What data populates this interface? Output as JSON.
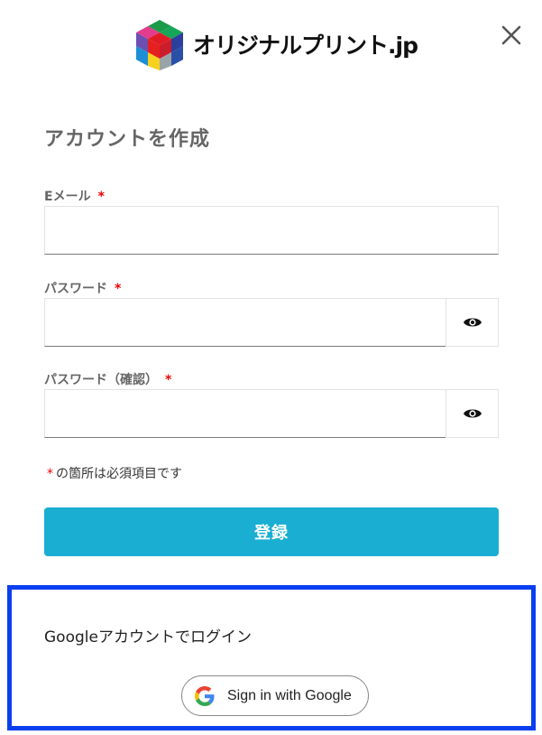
{
  "header": {
    "logo_text": "オリジナルプリント.jp",
    "close_icon": "close-icon"
  },
  "form": {
    "title": "アカウントを作成",
    "required_mark": "*",
    "email": {
      "label": "Eメール",
      "value": "",
      "placeholder": ""
    },
    "password": {
      "label": "パスワード",
      "value": "",
      "placeholder": ""
    },
    "password_confirm": {
      "label": "パスワード（確認）",
      "value": "",
      "placeholder": ""
    },
    "toggle_icon": "eye-icon",
    "note_mark": "*",
    "note_text": "の箇所は必須項目です",
    "submit_label": "登録"
  },
  "google": {
    "title": "Googleアカウントでログイン",
    "button_label": "Sign in with Google",
    "button_icon": "google-g-icon",
    "border_color": "#0a3ff0"
  },
  "colors": {
    "accent": "#1aaed3",
    "required": "#ee0000"
  }
}
